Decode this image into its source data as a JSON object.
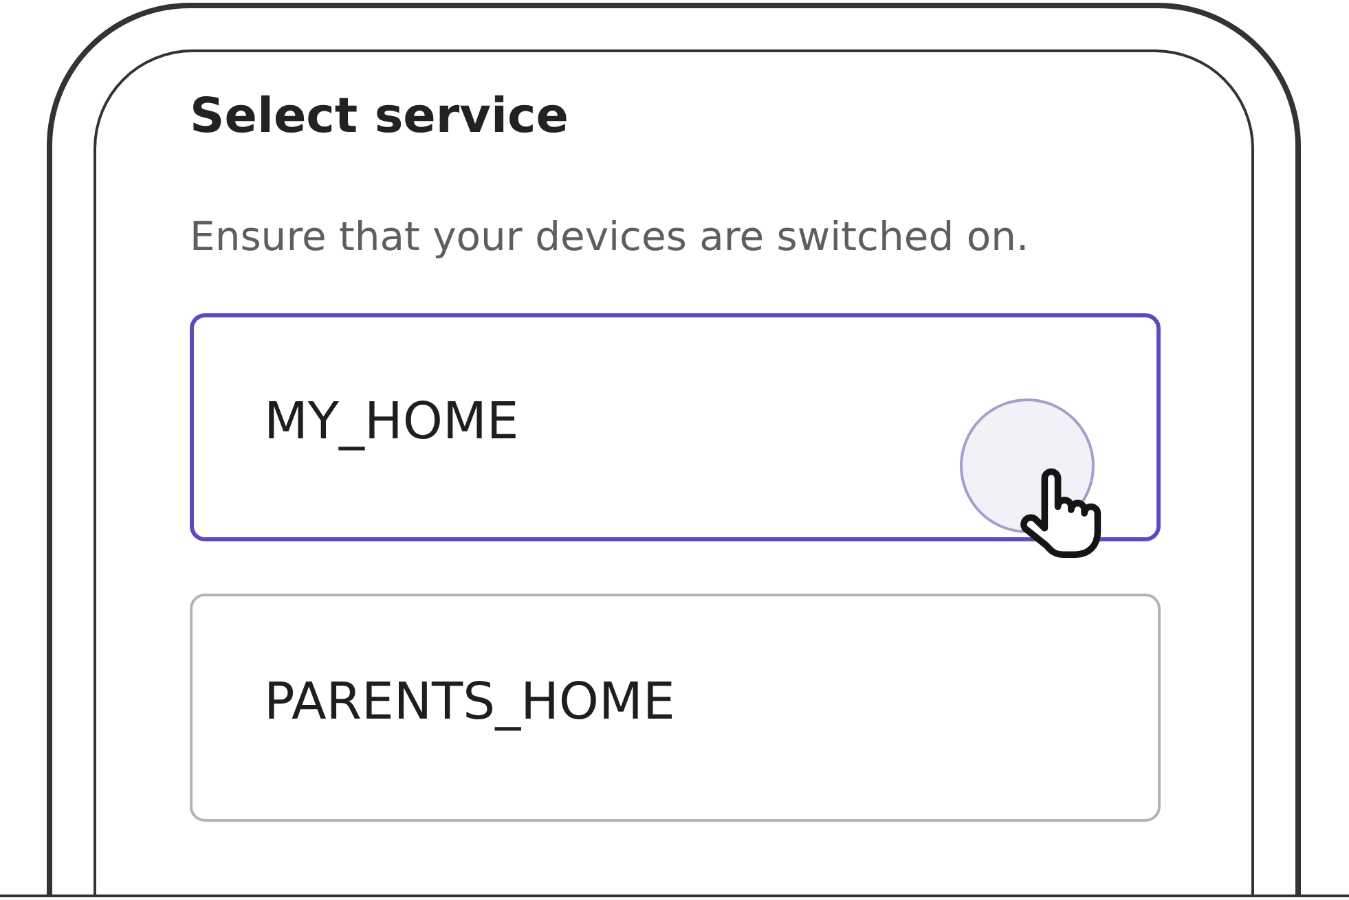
{
  "screen": {
    "title": "Select service",
    "subtitle": "Ensure that your devices are switched on.",
    "services": [
      {
        "name": "MY_HOME",
        "selected": true
      },
      {
        "name": "PARENTS_HOME",
        "selected": false
      }
    ]
  }
}
